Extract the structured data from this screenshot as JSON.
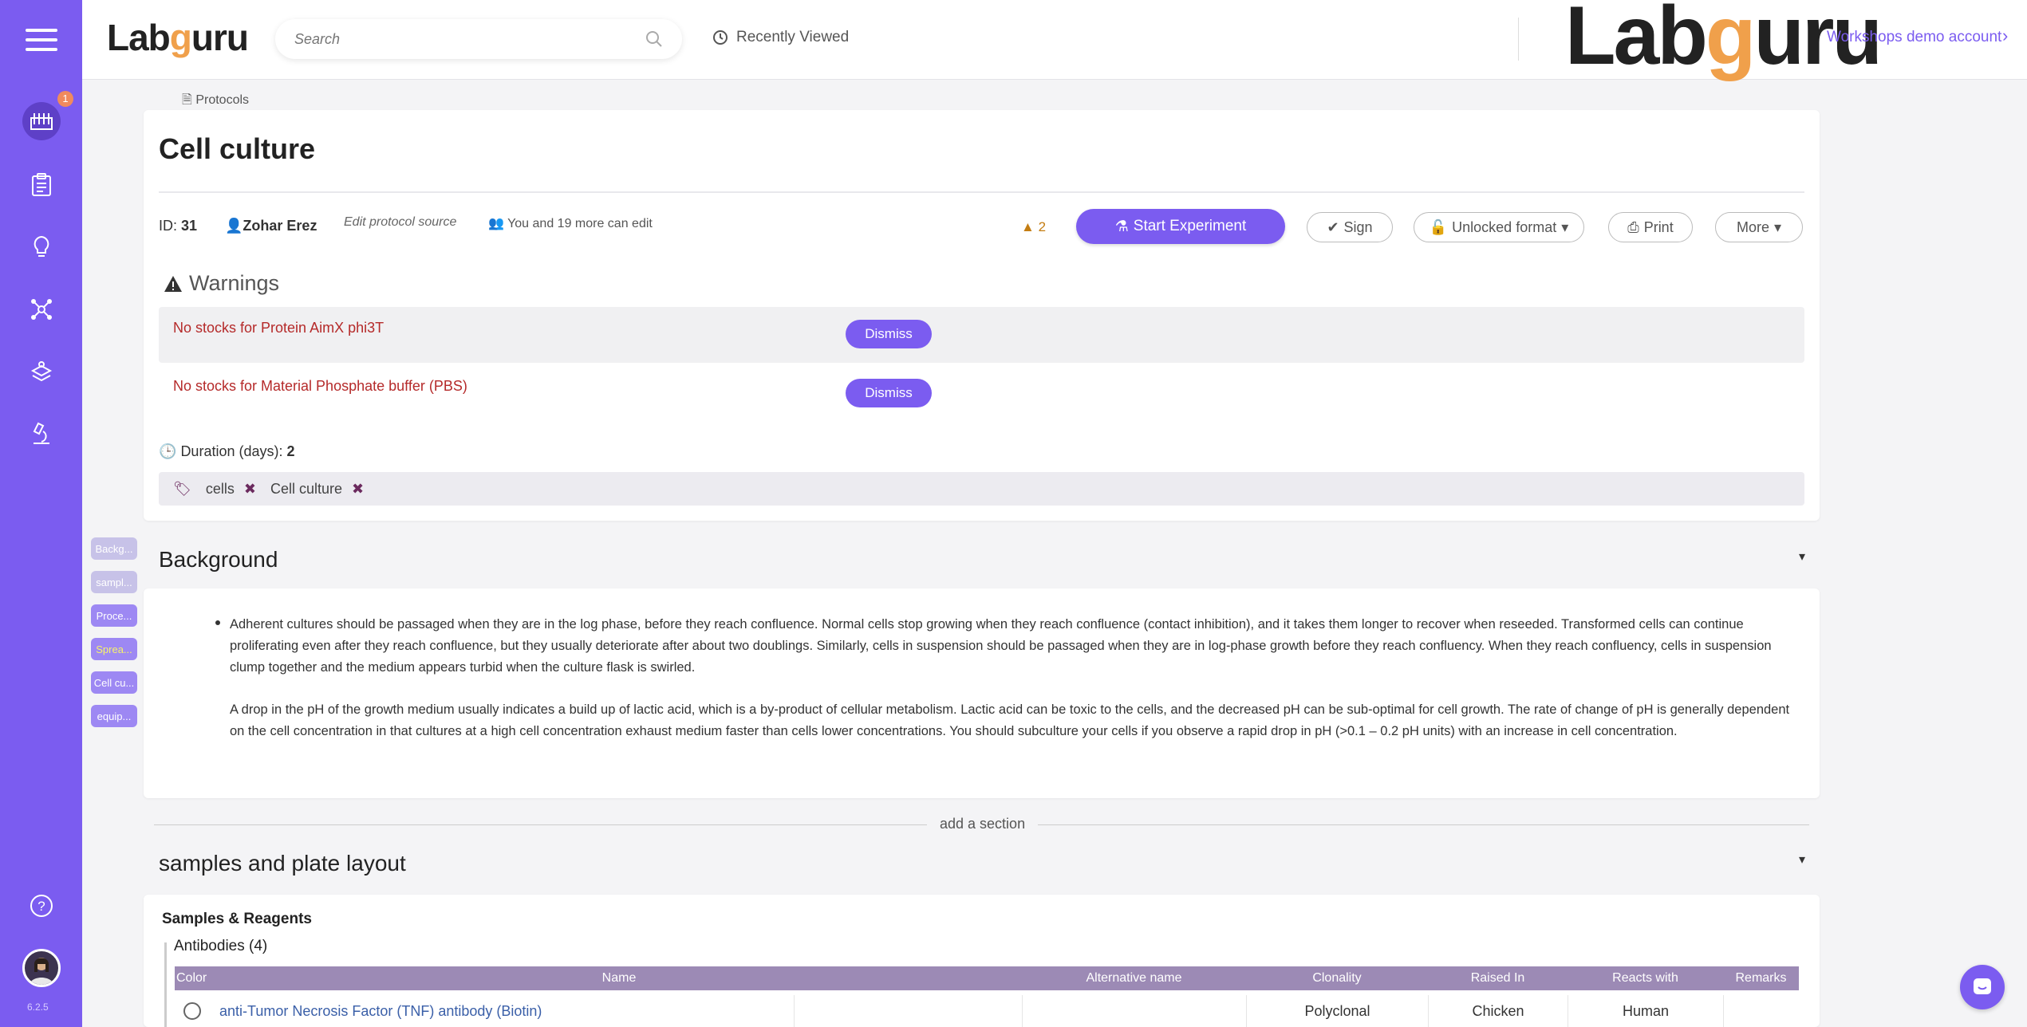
{
  "app": {
    "logo": "Labguru",
    "version": "6.2.5",
    "notifications": "1"
  },
  "search": {
    "placeholder": "Search"
  },
  "header": {
    "recently_viewed": "Recently Viewed",
    "account": "Workshops demo account"
  },
  "breadcrumb": {
    "protocols": "Protocols"
  },
  "protocol": {
    "title": "Cell culture",
    "id_label": "ID:",
    "id_value": "31",
    "owner": "Zohar Erez",
    "edit_source": "Edit protocol source",
    "editors": "You and 19 more can edit",
    "warning_count": "2",
    "start_experiment": "Start Experiment",
    "sign": "Sign",
    "format": "Unlocked format",
    "print": "Print",
    "more": "More"
  },
  "warnings": {
    "title": "Warnings",
    "items": [
      {
        "text": "No stocks for Protein AimX phi3T",
        "action": "Dismiss"
      },
      {
        "text": "No stocks for Material Phosphate buffer (PBS)",
        "action": "Dismiss"
      }
    ]
  },
  "duration": {
    "label": "Duration (days):",
    "value": "2"
  },
  "tags": [
    "cells",
    "Cell culture"
  ],
  "section_nav": [
    "Backg...",
    "sampl...",
    "Proce...",
    "Sprea...",
    "Cell cu...",
    "equip..."
  ],
  "background": {
    "title": "Background",
    "paragraph1": "Adherent cultures should be passaged when they are in the log phase, before they reach confluence.  Normal cells stop growing when they reach confluence (contact inhibition), and it takes them longer to recover when reseeded.  Transformed cells can continue proliferating even after they reach confluence, but they usually deteriorate after about two doublings. Similarly, cells in suspension should be passaged when they are in log-phase growth before they reach confluency.  When they reach confluency, cells in suspension clump together and the medium appears turbid when the culture flask is swirled.",
    "paragraph2": "A drop in the pH of the growth medium usually indicates a build up of lactic acid, which is a by-product of cellular metabolism.  Lactic acid can be toxic to the cells, and the decreased pH can be sub-optimal for cell growth.  The rate of change of pH is generally dependent on the cell concentration in that cultures at a high cell concentration exhaust medium faster than cells lower concentrations.  You should subculture your cells if you observe a rapid drop in pH (>0.1 – 0.2 pH units) with an increase in cell concentration."
  },
  "add_section": "add a section",
  "samples": {
    "title": "samples and plate layout",
    "label": "Samples & Reagents",
    "group": "Antibodies (4)",
    "columns": [
      "Color",
      "Name",
      "Alternative name",
      "Clonality",
      "Raised In",
      "Reacts with",
      "Remarks"
    ],
    "rows": [
      {
        "name": "anti-Tumor Necrosis Factor (TNF) antibody (Biotin)",
        "alt": "",
        "clonality": "Polyclonal",
        "raised_in": "Chicken",
        "reacts_with": "Human",
        "remarks": ""
      }
    ]
  },
  "colors": {
    "brand": "#7b5cf0",
    "warning_text": "#b52a2a",
    "table_header": "#9c8ab5"
  }
}
